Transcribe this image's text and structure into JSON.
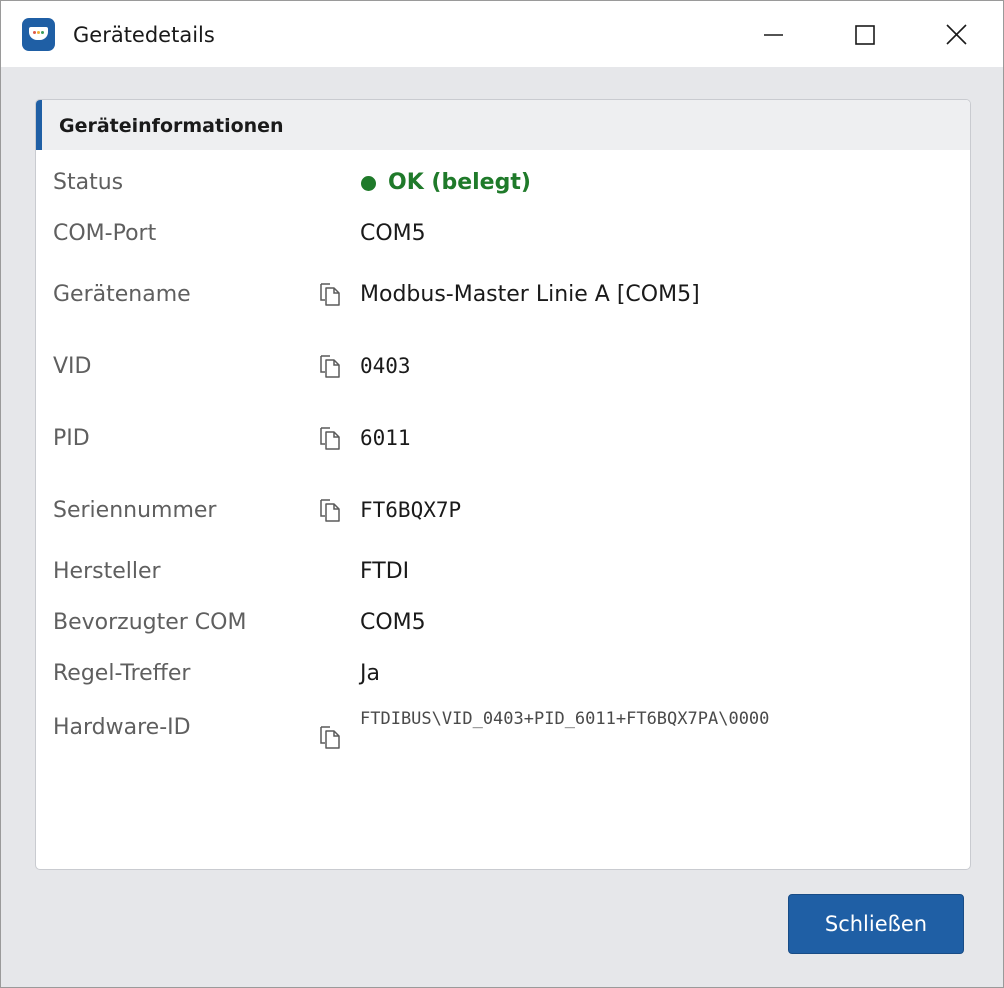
{
  "window": {
    "title": "Gerätedetails",
    "icon": "app-icon"
  },
  "panel": {
    "title": "Geräteinformationen",
    "rows": {
      "status": {
        "label": "Status",
        "value": "OK (belegt)",
        "color": "#1f7a2a"
      },
      "com_port": {
        "label": "COM-Port",
        "value": "COM5"
      },
      "device_name": {
        "label": "Gerätename",
        "value": "Modbus-Master Linie A [COM5]"
      },
      "vid": {
        "label": "VID",
        "value": "0403"
      },
      "pid": {
        "label": "PID",
        "value": "6011"
      },
      "serial": {
        "label": "Seriennummer",
        "value": "FT6BQX7P"
      },
      "manufacturer": {
        "label": "Hersteller",
        "value": "FTDI"
      },
      "preferred_com": {
        "label": "Bevorzugter COM",
        "value": "COM5"
      },
      "rule_match": {
        "label": "Regel-Treffer",
        "value": "Ja"
      },
      "hardware_id": {
        "label": "Hardware-ID",
        "value": "FTDIBUS\\VID_0403+PID_6011+FT6BQX7PA\\0000"
      }
    }
  },
  "footer": {
    "close_label": "Schließen"
  },
  "colors": {
    "accent": "#1f5fa5",
    "status_ok": "#1f7a2a"
  }
}
